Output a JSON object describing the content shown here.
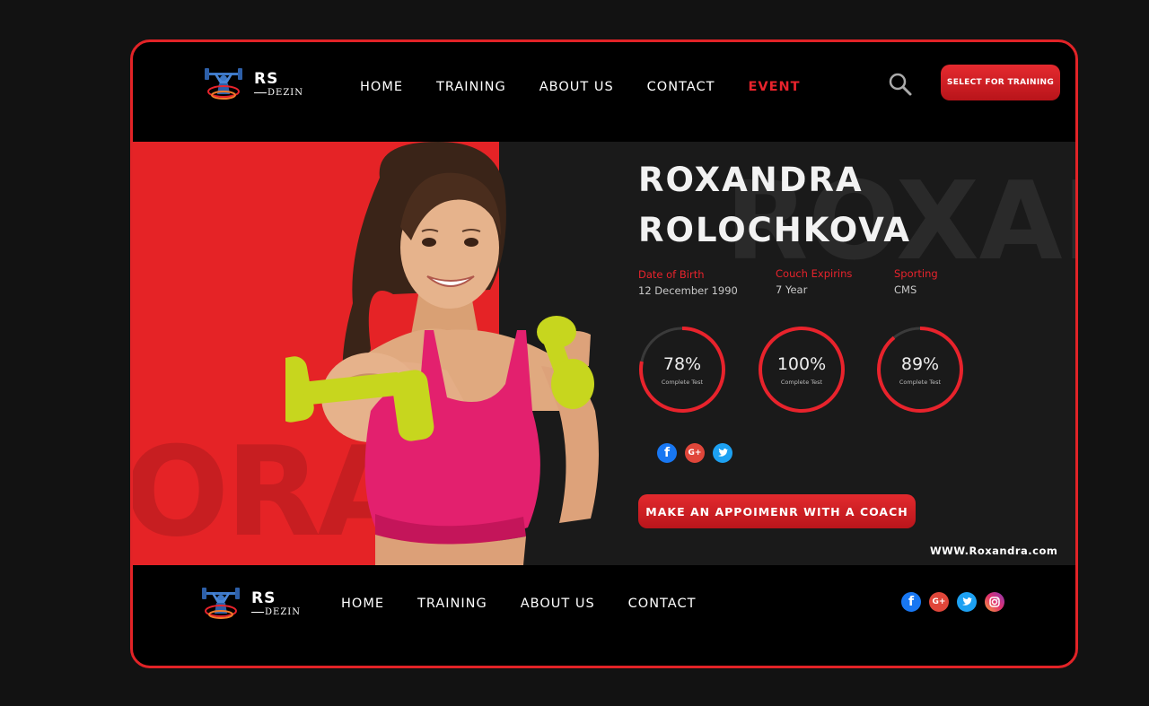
{
  "brand": {
    "name_top": "RS",
    "name_bottom": "DEZIN"
  },
  "header": {
    "nav": [
      {
        "label": "HOME",
        "active": false
      },
      {
        "label": "TRAINING",
        "active": false
      },
      {
        "label": "ABOUT US",
        "active": false
      },
      {
        "label": "CONTACT",
        "active": false
      },
      {
        "label": "EVENT",
        "active": true
      }
    ],
    "search_icon": "search-icon",
    "cta_label": "SELECT FOR TRAINING"
  },
  "hero": {
    "first_name": "ROXANDRA",
    "last_name": "ROLOCHKOVA",
    "bg_text_right": "ROXAN",
    "bg_text_left": "ORA",
    "info": [
      {
        "label": "Date of Birth",
        "value": "12 December 1990"
      },
      {
        "label": "Couch Expirins",
        "value": "7 Year"
      },
      {
        "label": "Sporting",
        "value": "CMS"
      }
    ],
    "stats": [
      {
        "value": "78%",
        "label": "Complete Test",
        "fraction": 0.78
      },
      {
        "value": "100%",
        "label": "Complete Test",
        "fraction": 1.0
      },
      {
        "value": "89%",
        "label": "Complete Test",
        "fraction": 0.89
      }
    ],
    "social": [
      "facebook-icon",
      "google-plus-icon",
      "twitter-icon"
    ],
    "appointment_label": "MAKE AN APPOIMENR WITH A COACH",
    "website": "WWW.Roxandra.com"
  },
  "footer": {
    "nav": [
      "HOME",
      "TRAINING",
      "ABOUT US",
      "CONTACT"
    ],
    "social": [
      "facebook-icon",
      "google-plus-icon",
      "twitter-icon",
      "instagram-icon"
    ]
  },
  "colors": {
    "accent": "#e52326",
    "background": "#000000",
    "panel": "#1a1a1a"
  }
}
